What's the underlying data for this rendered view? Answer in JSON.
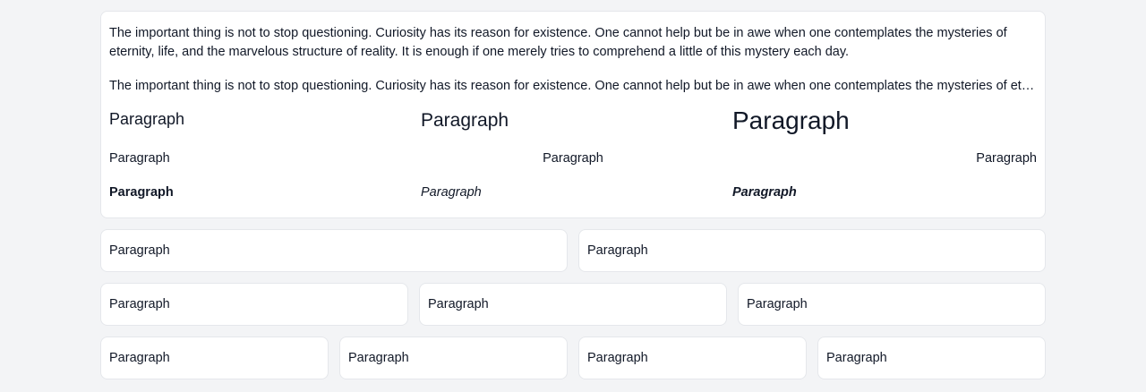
{
  "main_card": {
    "long_paragraph": "The important thing is not to stop questioning. Curiosity has its reason for existence. One cannot help but be in awe when one contemplates the mysteries of eternity, life, and the marvelous structure of reality. It is enough if one merely tries to comprehend a little of this mystery each day.",
    "clipped_paragraph": "The important thing is not to stop questioning. Curiosity has its reason for existence. One cannot help but be in awe when one contemplates the mysteries of eternity, life, and the marvelous structure of reality. It is enough if one merely tries to comprehend a little of this mystery each day.",
    "sizes": [
      "Paragraph",
      "Paragraph",
      "Paragraph"
    ],
    "alignments": [
      "Paragraph",
      "Paragraph",
      "Paragraph"
    ],
    "styles": [
      "Paragraph",
      "Paragraph",
      "Paragraph"
    ]
  },
  "row_two": [
    "Paragraph",
    "Paragraph"
  ],
  "row_three": [
    "Paragraph",
    "Paragraph",
    "Paragraph"
  ],
  "row_four": [
    "Paragraph",
    "Paragraph",
    "Paragraph",
    "Paragraph"
  ]
}
